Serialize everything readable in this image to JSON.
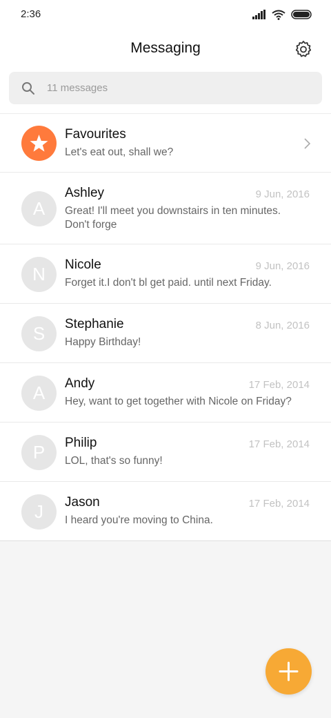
{
  "status_bar": {
    "time": "2:36"
  },
  "header": {
    "title": "Messaging"
  },
  "search": {
    "placeholder": "11 messages"
  },
  "favourites": {
    "name": "Favourites",
    "preview": "Let's eat out, shall we?"
  },
  "conversations": [
    {
      "initial": "A",
      "name": "Ashley",
      "date": "9 Jun, 2016",
      "preview": "Great! I'll meet you downstairs in ten minutes. Don't forge"
    },
    {
      "initial": "N",
      "name": "Nicole",
      "date": "9 Jun, 2016",
      "preview": "Forget it.I don't bl get paid. until next Friday."
    },
    {
      "initial": "S",
      "name": "Stephanie",
      "date": "8 Jun, 2016",
      "preview": "Happy Birthday!"
    },
    {
      "initial": "A",
      "name": "Andy",
      "date": "17 Feb, 2014",
      "preview": "Hey, want to get together with Nicole on Friday?"
    },
    {
      "initial": "P",
      "name": "Philip",
      "date": "17 Feb, 2014",
      "preview": "LOL, that's so funny!"
    },
    {
      "initial": "J",
      "name": "Jason",
      "date": "17 Feb, 2014",
      "preview": "I heard you're moving to China."
    }
  ],
  "colors": {
    "fab": "#f7a935",
    "favourite_avatar": "#ff7a3c",
    "avatar": "#e6e6e6"
  },
  "icons": [
    "signal-icon",
    "wifi-icon",
    "battery-icon",
    "settings-icon",
    "search-icon",
    "star-icon",
    "chevron-right-icon",
    "plus-icon"
  ]
}
